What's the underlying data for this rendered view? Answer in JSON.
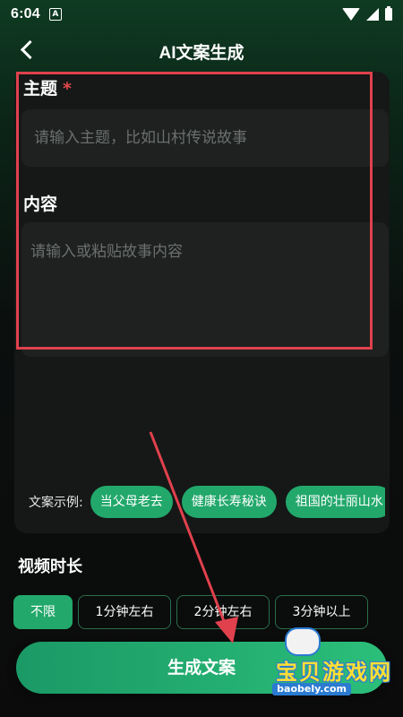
{
  "status_bar": {
    "time": "6:04",
    "app_badge": "A"
  },
  "app_bar": {
    "title": "AI文案生成"
  },
  "form": {
    "topic_label": "主题",
    "required_mark": "*",
    "topic_placeholder": "请输入主题，比如山村传说故事",
    "content_label": "内容",
    "content_placeholder": "请输入或粘贴故事内容",
    "examples_label": "文案示例:",
    "examples": [
      "当父母老去",
      "健康长寿秘诀",
      "祖国的壮丽山水"
    ]
  },
  "duration": {
    "label": "视频时长",
    "options": [
      "不限",
      "1分钟左右",
      "2分钟左右",
      "3分钟以上"
    ],
    "selected": "不限"
  },
  "generate_button": "生成文案",
  "watermark": {
    "text": "宝贝游戏网",
    "domain": "baobely.com"
  },
  "colors": {
    "accent": "#22a86b",
    "highlight": "#e0414d"
  }
}
